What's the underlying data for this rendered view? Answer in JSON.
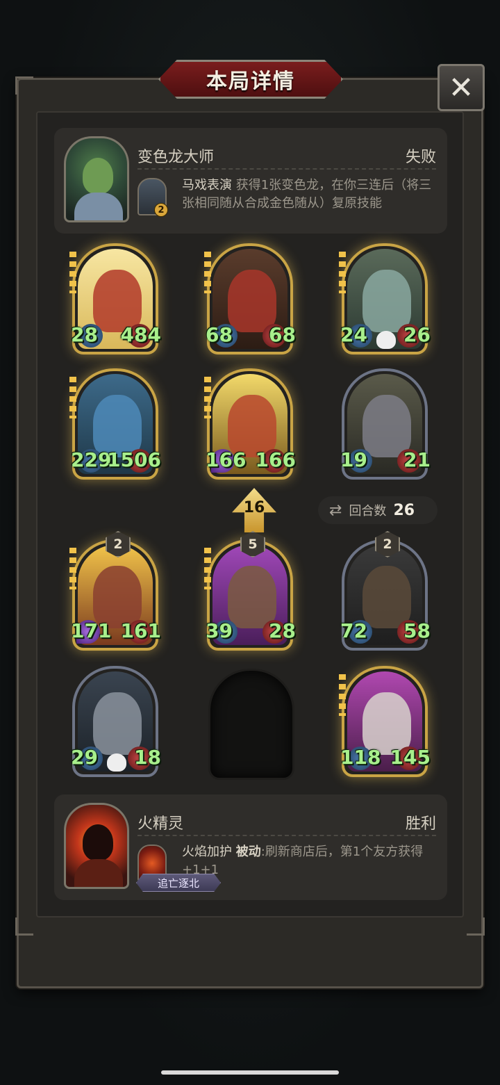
{
  "title": "本局详情",
  "close_label": "✕",
  "top_player": {
    "name": "变色龙大师",
    "result": "失败",
    "skill_badge": "2",
    "skill_name": "马戏表演",
    "skill_desc": " 获得1张变色龙，在你三连后（将三张相同随从合成金色随从）复原技能"
  },
  "bottom_player": {
    "name": "火精灵",
    "result": "胜利",
    "skill_name": "火焰加护",
    "skill_passive": "被动",
    "skill_desc": ":刷新商店后，第1个友方获得+1+1",
    "tag": "追亡逐北"
  },
  "opponent_cards": [
    {
      "attack": "28",
      "health": "484"
    },
    {
      "attack": "68",
      "health": "68"
    },
    {
      "attack": "24",
      "health": "26"
    },
    {
      "attack": "229",
      "health": "1506"
    },
    {
      "attack": "166",
      "health": "166"
    },
    {
      "attack": "19",
      "health": "21"
    }
  ],
  "round": {
    "arrow_value": "16",
    "turns_label": "回合数",
    "turns_value": "26"
  },
  "own_cards": [
    {
      "level": "2",
      "attack": "171",
      "health": "161"
    },
    {
      "level": "5",
      "attack": "39",
      "health": "28"
    },
    {
      "level": "2",
      "attack": "72",
      "health": "58"
    },
    {
      "attack": "29",
      "health": "18"
    },
    {
      "attack": "118",
      "health": "145"
    }
  ],
  "colors": {
    "title_banner": "#7a1d1d",
    "gold_frame": "#c9a445",
    "silver_frame": "#6d7486",
    "stat_text": "#a8ef8c"
  },
  "icons": [
    "close-icon",
    "swap-arrows-icon",
    "up-arrow-icon",
    "skull-icon"
  ]
}
